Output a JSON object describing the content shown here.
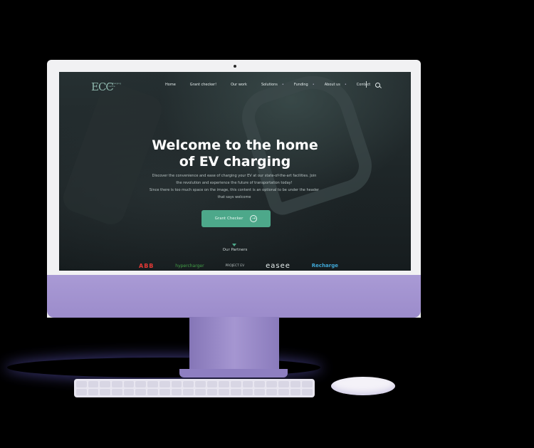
{
  "nav": {
    "logo": "ECC",
    "logo_sub": "EV charging centre",
    "links": [
      "Home",
      "Grant checker!",
      "Our work",
      "Solutions",
      "Funding",
      "About us",
      "Contact"
    ]
  },
  "hero": {
    "title_line1": "Welcome to the home",
    "title_line2": "of EV charging",
    "text_line1": "Discover the convenience and ease of charging your EV at our state-of-the-art facilities. Join",
    "text_line2": "the revolution and experience the future of transportation today!",
    "text_line3": "Since there is too much space on the image, this content is an optional to be under the header",
    "text_line4": "that says welcome",
    "cta_label": "Grant Checker",
    "cta_icon": "arrow-right-circle-icon"
  },
  "partners": {
    "title": "Our Partners",
    "logos": [
      "ABB",
      "hypercharger",
      "PROJECT EV",
      "easee",
      "Recharge"
    ]
  },
  "colors": {
    "accent": "#4da88a",
    "screen_bg": "#1f2729",
    "device": "#a99ad5"
  }
}
